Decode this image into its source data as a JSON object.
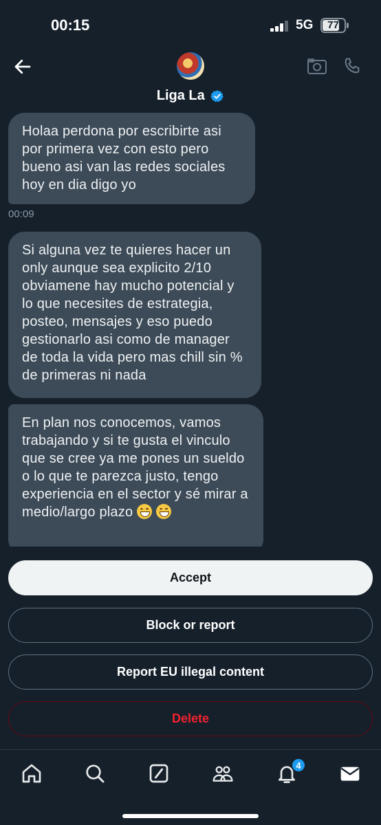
{
  "status_bar": {
    "time": "00:15",
    "network": "5G",
    "battery": "77",
    "battery_level": 0.77
  },
  "header": {
    "contact_name": "Liga La",
    "verified": true,
    "icons": [
      "back-arrow-icon",
      "video-call-icon",
      "phone-call-icon"
    ]
  },
  "messages": [
    {
      "text": "Holaa perdona por escribirte asi por primera vez con esto pero bueno asi van las redes sociales hoy en dia digo yo",
      "time": "00:09"
    },
    {
      "text": "Si alguna vez te quieres hacer un only aunque sea explicito 2/10 obviamene hay mucho potencial y lo que necesites de estrategia, posteo, mensajes y eso puedo gestionarlo asi como de manager de toda la vida pero mas chill sin % de primeras ni nada"
    },
    {
      "text": "En plan nos conocemos, vamos trabajando y si te gusta el vinculo que se cree ya me pones un sueldo o lo que te parezca justo, tengo experiencia en el sector y sé mirar a medio/largo plazo",
      "emojis": [
        "grinning-face",
        "grinning-face"
      ]
    }
  ],
  "actions": {
    "accept": "Accept",
    "block": "Block or report",
    "report_eu": "Report EU illegal content",
    "delete": "Delete"
  },
  "bottom_nav": {
    "items": [
      "home-icon",
      "search-icon",
      "grok-icon",
      "communities-icon",
      "notifications-icon",
      "messages-icon"
    ],
    "notifications_badge": "4"
  },
  "colors": {
    "background": "#15202b",
    "bubble": "#3d4b58",
    "accent": "#1d9bf0",
    "danger": "#f4212e"
  }
}
